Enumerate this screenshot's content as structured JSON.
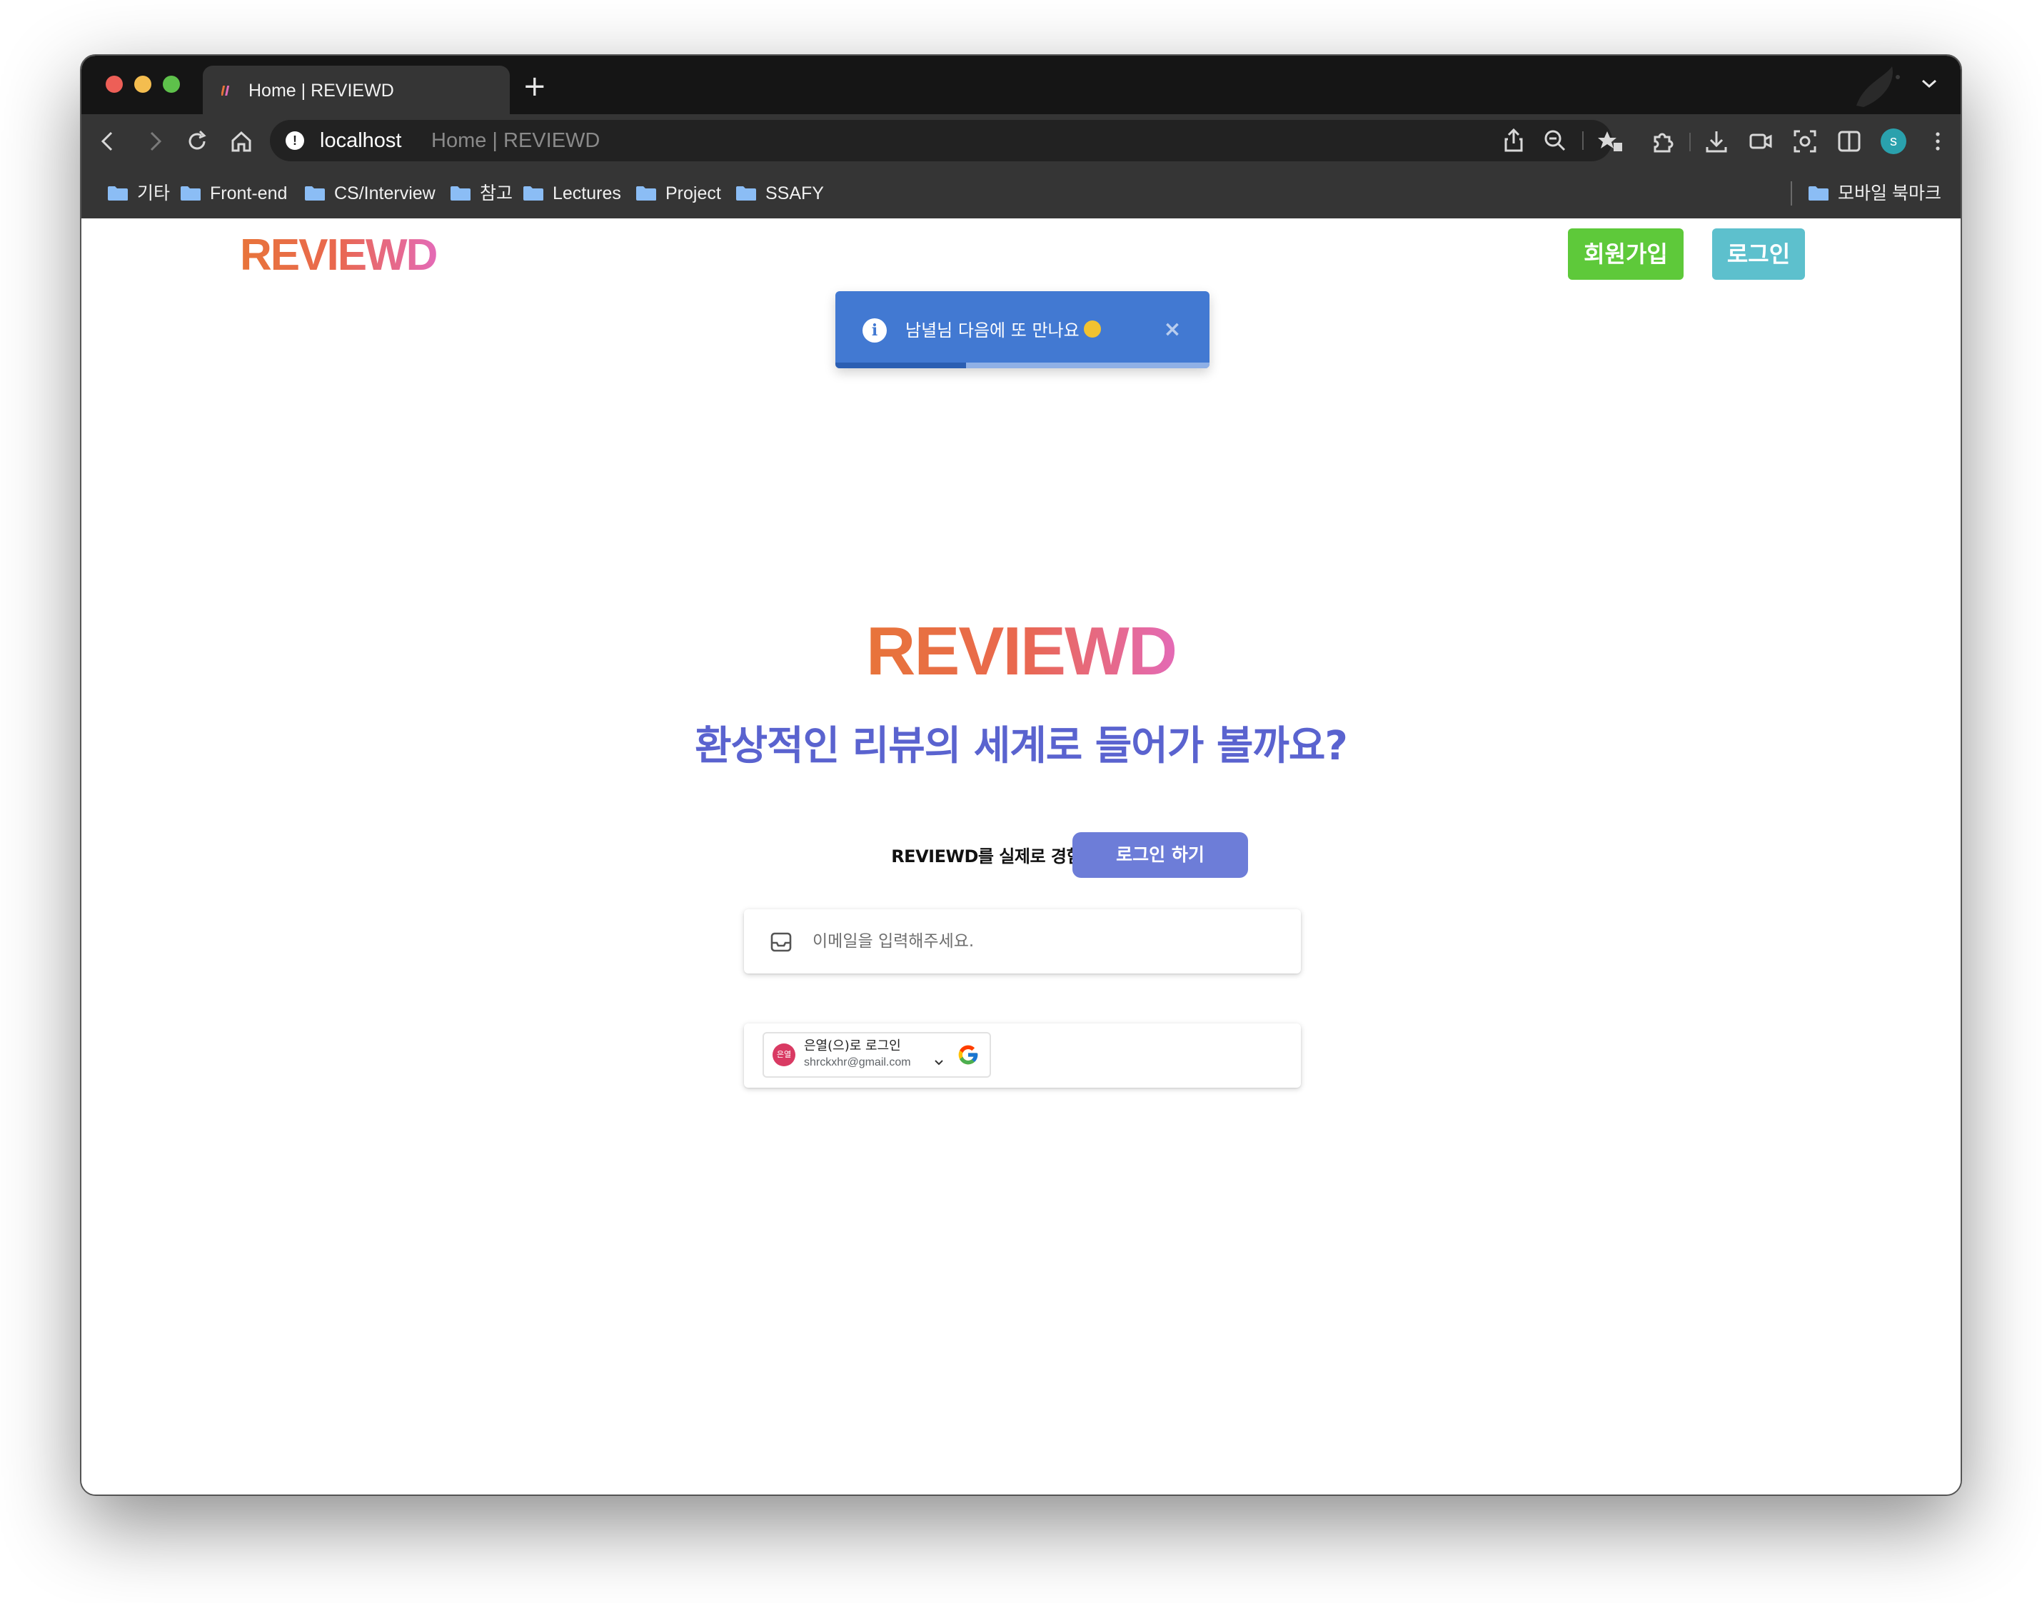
{
  "browser": {
    "tab_title": "Home | REVIEWD",
    "new_tab_symbol": "+",
    "address": {
      "host": "localhost",
      "page_title": "Home | REVIEWD"
    },
    "profile_initial": "s",
    "bookmarks": [
      "기타",
      "Front-end",
      "CS/Interview",
      "참고",
      "Lectures",
      "Project",
      "SSAFY"
    ],
    "mobile_bookmarks": "모바일 북마크",
    "icons": [
      "back-icon",
      "forward-icon",
      "reload-icon",
      "home-icon",
      "info-icon",
      "share-icon",
      "zoom-out-icon",
      "favorites-icon",
      "extensions-icon",
      "download-icon",
      "screen-record-icon",
      "screenshot-icon",
      "sidebar-icon",
      "more-menu-icon"
    ]
  },
  "header": {
    "logo": "REVIEWD",
    "signup_label": "회원가입",
    "login_label": "로그인",
    "signup_color": "#5ec93a",
    "login_color": "#5dc0cd"
  },
  "toast": {
    "info_symbol": "i",
    "message": "남녈님 다음에 또 만나요",
    "close_symbol": "×",
    "progress": 0.35,
    "color": "#4279d2"
  },
  "hero": {
    "logo": "REVIEWD",
    "headline": "환상적인 리뷰의 세계로 들어가 볼까요?",
    "tagline": "REVIEWD를 실제로 경험해보세요.",
    "cta_label": "로그인 하기",
    "headline_color": "#5a63cf",
    "cta_color": "#6d7dd8"
  },
  "email_form": {
    "placeholder": "이메일을 입력해주세요."
  },
  "google_signin": {
    "avatar_text": "은열",
    "name_label": "은열(으)로 로그인",
    "email": "shrckxhr@gmail.com"
  }
}
